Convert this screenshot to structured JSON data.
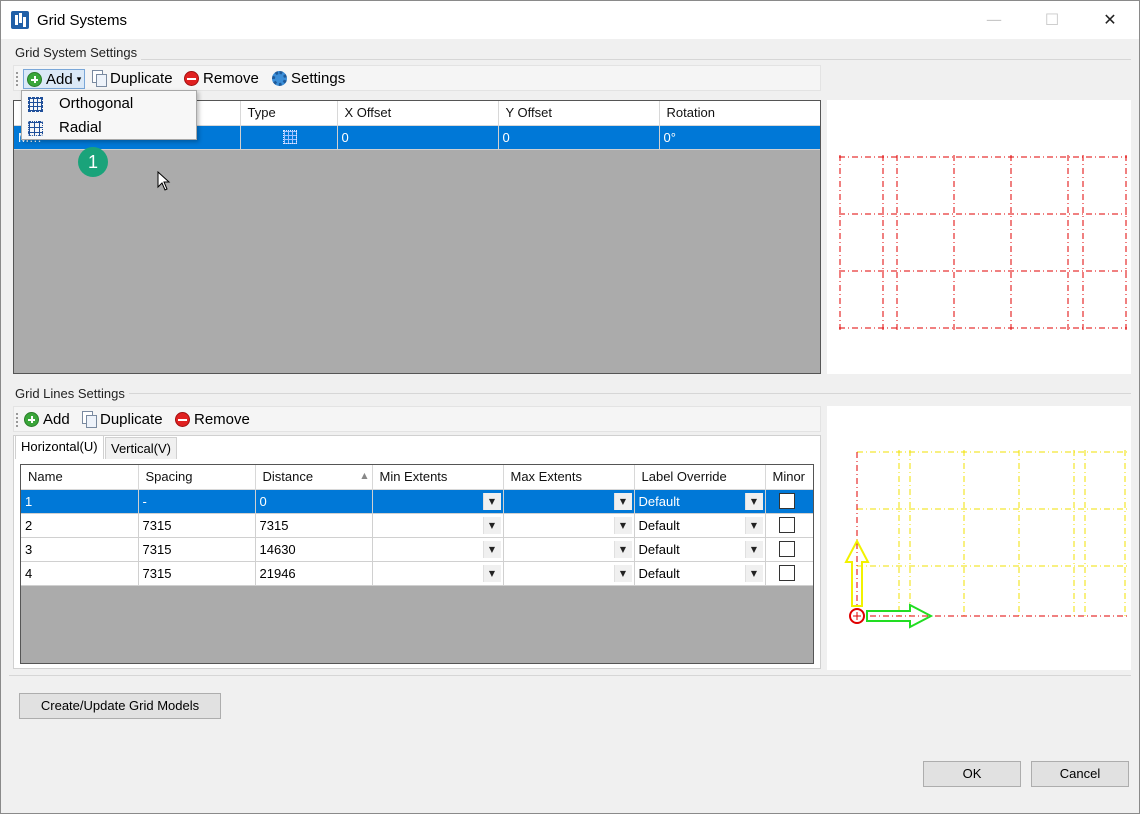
{
  "window": {
    "title": "Grid Systems",
    "minimize_glyph": "—",
    "maximize_glyph": "☐",
    "close_glyph": "✕"
  },
  "grid_system_settings": {
    "group_label": "Grid System Settings",
    "toolbar": {
      "add": "Add",
      "duplicate": "Duplicate",
      "remove": "Remove",
      "settings": "Settings"
    },
    "add_menu": {
      "items": [
        "Orthogonal",
        "Radial"
      ]
    },
    "columns": [
      "",
      "Type",
      "X Offset",
      "Y Offset",
      "Rotation"
    ],
    "rows": [
      {
        "name": "M…",
        "type": "orthogonal-icon",
        "x_offset": "0",
        "y_offset": "0",
        "rotation": "0°",
        "selected": true
      }
    ],
    "step_badge": "1"
  },
  "grid_lines_settings": {
    "group_label": "Grid Lines Settings",
    "toolbar": {
      "add": "Add",
      "duplicate": "Duplicate",
      "remove": "Remove"
    },
    "tabs": [
      "Horizontal(U)",
      "Vertical(V)"
    ],
    "active_tab": "Horizontal(U)",
    "columns": [
      "Name",
      "Spacing",
      "Distance",
      "Min Extents",
      "Max Extents",
      "Label Override",
      "Minor"
    ],
    "rows": [
      {
        "name": "1",
        "spacing": "-",
        "distance": "0",
        "min_extents": "",
        "max_extents": "",
        "label_override": "Default",
        "minor": false,
        "selected": true
      },
      {
        "name": "2",
        "spacing": "7315",
        "distance": "7315",
        "min_extents": "",
        "max_extents": "",
        "label_override": "Default",
        "minor": false,
        "selected": false
      },
      {
        "name": "3",
        "spacing": "7315",
        "distance": "14630",
        "min_extents": "",
        "max_extents": "",
        "label_override": "Default",
        "minor": false,
        "selected": false
      },
      {
        "name": "4",
        "spacing": "7315",
        "distance": "21946",
        "min_extents": "",
        "max_extents": "",
        "label_override": "Default",
        "minor": false,
        "selected": false
      }
    ]
  },
  "footer": {
    "create_update": "Create/Update Grid Models",
    "ok": "OK",
    "cancel": "Cancel"
  },
  "colors": {
    "selection": "#0078d7",
    "grid_preview_lines": "#e00000",
    "grid_lines_preview": "#f0e000",
    "axis_x_arrow": "#22dd22",
    "axis_y_arrow": "#eeee00"
  }
}
